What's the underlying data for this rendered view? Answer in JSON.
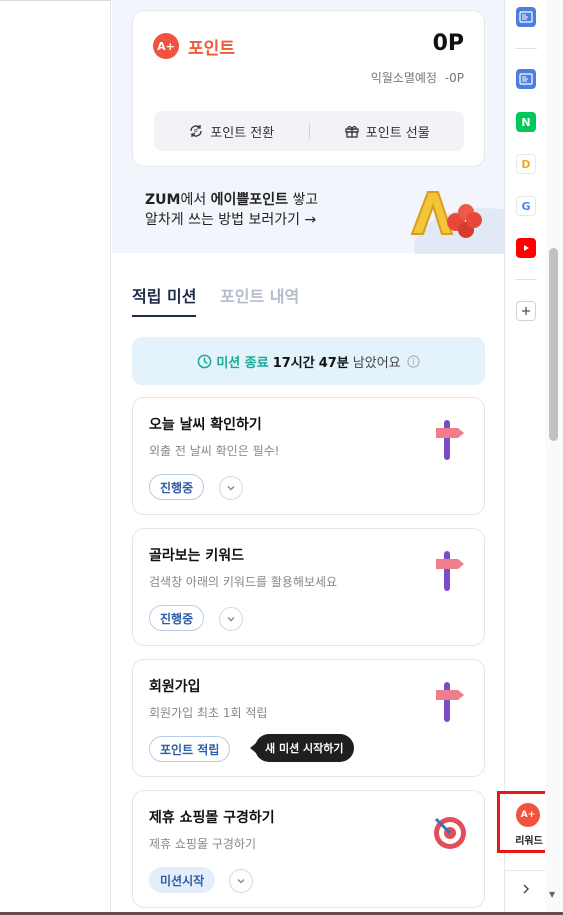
{
  "points": {
    "logo_text": "A+",
    "title": "포인트",
    "value": "0P",
    "expire_label": "익월소멸예정",
    "expire_value": "-0P",
    "convert_label": "포인트 전환",
    "gift_label": "포인트 선물"
  },
  "promo": {
    "line1_a": "ZUM",
    "line1_b": "에서 ",
    "line1_c": "에이쁠포인트",
    "line1_d": " 쌓고",
    "line2": "알차게 쓰는 방법 보러가기 →"
  },
  "tabs": [
    {
      "label": "적립 미션",
      "active": true
    },
    {
      "label": "포인트 내역",
      "active": false
    }
  ],
  "timer": {
    "label": "미션 종료",
    "hours": "17시간",
    "minutes": "47분",
    "suffix": "남았어요"
  },
  "missions": [
    {
      "title": "오늘 날씨 확인하기",
      "desc": "외출 전 날씨 확인은 필수!",
      "status": "진행중",
      "art": "signpost-icon"
    },
    {
      "title": "골라보는 키워드",
      "desc": "검색창 아래의 키워드를 활용해보세요",
      "status": "진행중",
      "art": "signpost-icon"
    },
    {
      "title": "회원가입",
      "desc": "회원가입 최초 1회 적립",
      "status": "포인트 적립",
      "tooltip": "새 미션 시작하기",
      "art": "signpost-icon"
    },
    {
      "title": "제휴 쇼핑몰 구경하기",
      "desc": "제휴 쇼핑몰 구경하기",
      "status": "미션시작",
      "art": "target-icon"
    }
  ],
  "sidebar": {
    "reward_logo": "A+",
    "reward_label": "리워드",
    "naver_letter": "N",
    "google_letter": "G",
    "daum_letter": "D"
  },
  "colors": {
    "accent": "#ee5a3b",
    "brand_blue": "#2d5ca8",
    "teal": "#19a99b",
    "highlight": "#e81818"
  }
}
